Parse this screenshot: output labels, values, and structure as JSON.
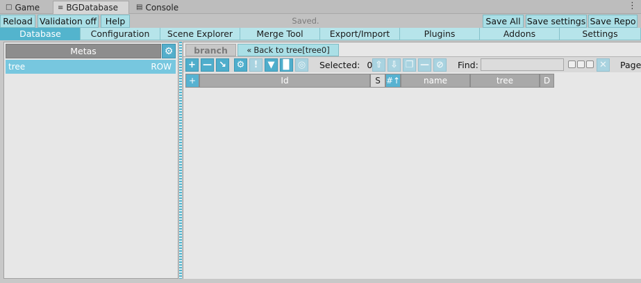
{
  "editor_tabs": [
    {
      "label": "Game",
      "icon": "gamepad-icon"
    },
    {
      "label": "BGDatabase",
      "icon": "list-icon"
    },
    {
      "label": "Console",
      "icon": "console-icon"
    }
  ],
  "top_buttons": {
    "reload": "Reload",
    "validation": "Validation off",
    "help": "Help",
    "status": "Saved.",
    "save_all": "Save All",
    "save_settings": "Save settings",
    "save_repo": "Save Repo"
  },
  "main_tabs": [
    "Database",
    "Configuration",
    "Scene Explorer",
    "Merge Tool",
    "Export/Import",
    "Plugins",
    "Addons",
    "Settings"
  ],
  "left": {
    "metas_header": "Metas",
    "metas": [
      {
        "name": "tree",
        "tag": "ROW"
      }
    ]
  },
  "right": {
    "branch_tab": "branch",
    "back_button": "Back to tree[tree0]",
    "selected_label": "Selected:",
    "selected_count": "0",
    "find_label": "Find:",
    "find_value": "",
    "page_label": "Page",
    "grid_headers": {
      "add": "+",
      "id": "Id",
      "s": "S",
      "sort": "#↑",
      "name": "name",
      "tree": "tree",
      "d": "D"
    }
  },
  "colors": {
    "accent": "#53b4cd",
    "tab_bg": "#b6e4ea",
    "button_bg": "#aadfe6"
  }
}
